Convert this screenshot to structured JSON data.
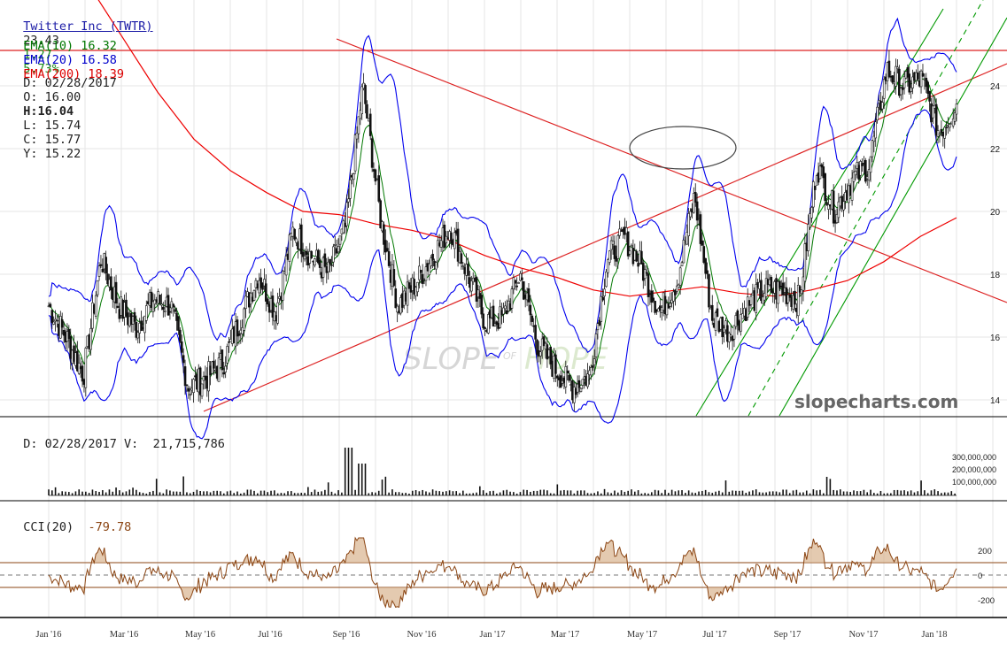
{
  "header": {
    "title": "Twitter Inc (TWTR)",
    "last": "23.43",
    "change": "1.27",
    "change_pct": "5.73%",
    "date": "D: 02/28/2017",
    "open": "O: 16.00",
    "high_label": "H:",
    "high_value": "16.04",
    "low": "L: 15.74",
    "close": "C: 15.77",
    "y": "Y: 15.22",
    "ema10": "EMA(10) 16.32",
    "ema20": "EMA(20) 16.58",
    "ema200": "EMA(200) 18.39"
  },
  "volume_panel": {
    "label": "D: 02/28/2017 V:",
    "value": "21,715,786"
  },
  "cci_panel": {
    "label": "CCI(20)",
    "value": "-79.78"
  },
  "watermark": {
    "word1": "SLOPE",
    "word2": "OF",
    "word3": "HOPE",
    "site": "slopecharts.com"
  },
  "colors": {
    "ema10": "#007700",
    "ema20": "#0000ee",
    "ema200": "#ee0000",
    "cci": "#8b4513",
    "candle": "#111111",
    "channel": "#009900"
  },
  "chart_data": {
    "type": "candlestick",
    "symbol": "TWTR",
    "price_axis": {
      "ticks": [
        14,
        16,
        18,
        20,
        22,
        24
      ],
      "range": [
        13.6,
        26.2
      ]
    },
    "volume_axis": {
      "ticks": [
        "300,000,000",
        "200,000,000",
        "100,000,000"
      ]
    },
    "cci_axis": {
      "ticks": [
        "200",
        "0",
        "-200"
      ]
    },
    "x_labels": [
      "Jan '16",
      "Mar '16",
      "May '16",
      "Jul '16",
      "Sep '16",
      "Nov '16",
      "Jan '17",
      "Mar '17",
      "May '17",
      "Jul '17",
      "Sep '17",
      "Nov '17",
      "Jan '18"
    ],
    "close_path": [
      [
        "Jan '16",
        17.0
      ],
      [
        "Jan '16",
        16.0
      ],
      [
        "Feb '16",
        14.8
      ],
      [
        "Feb '16",
        18.5
      ],
      [
        "Mar '16",
        17.0
      ],
      [
        "Mar '16",
        16.3
      ],
      [
        "Apr '16",
        17.2
      ],
      [
        "Apr '16",
        17.0
      ],
      [
        "May '16",
        14.4
      ],
      [
        "May '16",
        14.7
      ],
      [
        "Jun '16",
        15.2
      ],
      [
        "Jun '16",
        16.6
      ],
      [
        "Jul '16",
        18.0
      ],
      [
        "Jul '16",
        16.8
      ],
      [
        "Aug '16",
        19.4
      ],
      [
        "Aug '16",
        18.6
      ],
      [
        "Sep '16",
        18.0
      ],
      [
        "Sep '16",
        19.5
      ],
      [
        "Oct '16",
        24.0
      ],
      [
        "Oct '16",
        19.8
      ],
      [
        "Oct '16",
        17.0
      ],
      [
        "Nov '16",
        17.7
      ],
      [
        "Nov '16",
        18.6
      ],
      [
        "Dec '16",
        19.5
      ],
      [
        "Dec '16",
        18.0
      ],
      [
        "Jan '17",
        16.5
      ],
      [
        "Jan '17",
        16.6
      ],
      [
        "Feb '17",
        18.0
      ],
      [
        "Feb '17",
        15.77
      ],
      [
        "Mar '17",
        15.0
      ],
      [
        "Apr '17",
        14.4
      ],
      [
        "Apr '17",
        14.8
      ],
      [
        "May '17",
        18.5
      ],
      [
        "May '17",
        19.2
      ],
      [
        "Jun '17",
        18.2
      ],
      [
        "Jun '17",
        16.8
      ],
      [
        "Jul '17",
        17.8
      ],
      [
        "Jul '17",
        20.5
      ],
      [
        "Aug '17",
        16.6
      ],
      [
        "Aug '17",
        16.2
      ],
      [
        "Sep '17",
        17.0
      ],
      [
        "Sep '17",
        17.5
      ],
      [
        "Oct '17",
        17.5
      ],
      [
        "Oct '17",
        17.2
      ],
      [
        "Oct '17",
        21.5
      ],
      [
        "Nov '17",
        20.0
      ],
      [
        "Nov '17",
        21.0
      ],
      [
        "Dec '17",
        21.5
      ],
      [
        "Dec '17",
        24.5
      ],
      [
        "Jan '18",
        24.0
      ],
      [
        "Jan '18",
        24.2
      ],
      [
        "Feb '18",
        22.5
      ],
      [
        "Feb '18",
        23.43
      ]
    ],
    "ema200_path": [
      [
        "Jan '16",
        30.0
      ],
      [
        "Feb '16",
        27.4
      ],
      [
        "Mar '16",
        25.6
      ],
      [
        "Apr '16",
        23.8
      ],
      [
        "May '16",
        22.3
      ],
      [
        "Jun '16",
        21.3
      ],
      [
        "Jul '16",
        20.6
      ],
      [
        "Aug '16",
        20.0
      ],
      [
        "Sep '16",
        19.9
      ],
      [
        "Oct '16",
        19.6
      ],
      [
        "Nov '16",
        19.4
      ],
      [
        "Dec '16",
        19.1
      ],
      [
        "Jan '17",
        18.6
      ],
      [
        "Feb '17",
        18.2
      ],
      [
        "Mar '17",
        17.9
      ],
      [
        "Apr '17",
        17.5
      ],
      [
        "May '17",
        17.3
      ],
      [
        "Jun '17",
        17.45
      ],
      [
        "Jul '17",
        17.6
      ],
      [
        "Aug '17",
        17.4
      ],
      [
        "Sep '17",
        17.3
      ],
      [
        "Oct '17",
        17.5
      ],
      [
        "Nov '17",
        17.8
      ],
      [
        "Dec '17",
        18.4
      ],
      [
        "Jan '18",
        19.2
      ],
      [
        "Feb '18",
        19.8
      ]
    ]
  }
}
